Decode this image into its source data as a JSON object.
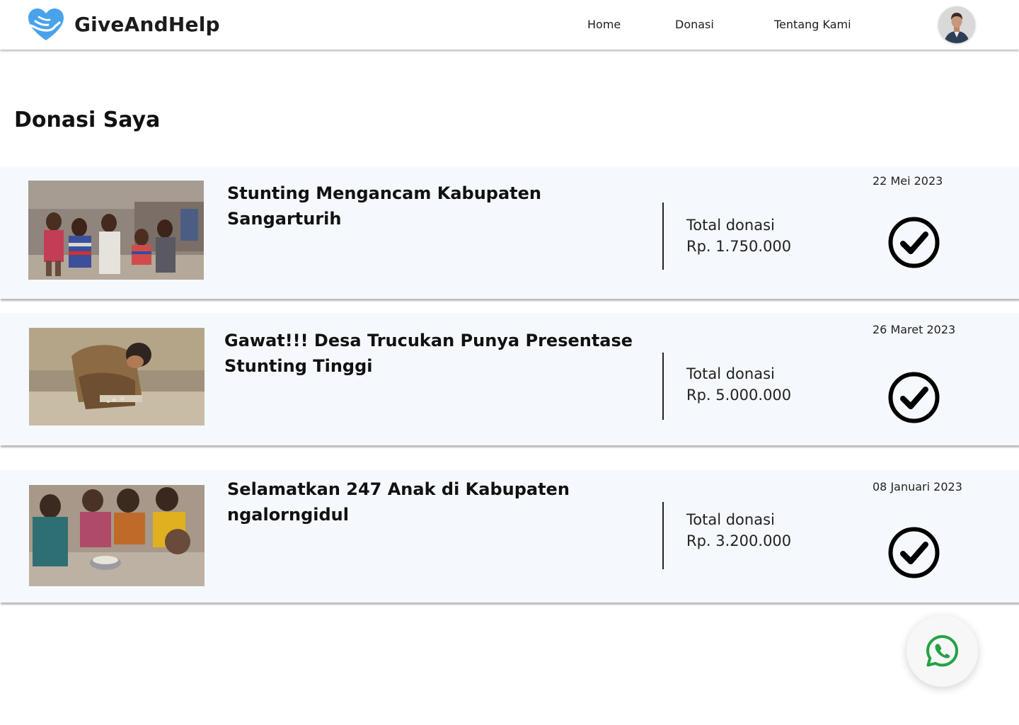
{
  "brand": {
    "name": "GiveAndHelp",
    "accent": "#3a9be8"
  },
  "nav": {
    "items": [
      {
        "label": "Home"
      },
      {
        "label": "Donasi"
      },
      {
        "label": "Tentang Kami"
      }
    ]
  },
  "page": {
    "title": "Donasi Saya"
  },
  "donations": [
    {
      "title": "Stunting Mengancam Kabupaten Sangarturih",
      "total_label": "Total donasi",
      "amount": "Rp. 1.750.000",
      "date": "22 Mei 2023",
      "status_icon": "check-circle-icon"
    },
    {
      "title": "Gawat!!! Desa Trucukan Punya Presentase Stunting Tinggi",
      "total_label": "Total donasi",
      "amount": "Rp. 5.000.000",
      "date": "26 Maret 2023",
      "status_icon": "check-circle-icon"
    },
    {
      "title": "Selamatkan 247 Anak di Kabupaten ngalorngidul",
      "total_label": "Total donasi",
      "amount": "Rp. 3.200.000",
      "date": "08 Januari 2023",
      "status_icon": "check-circle-icon"
    }
  ],
  "floating": {
    "icon": "whatsapp-icon",
    "color": "#25a244"
  }
}
